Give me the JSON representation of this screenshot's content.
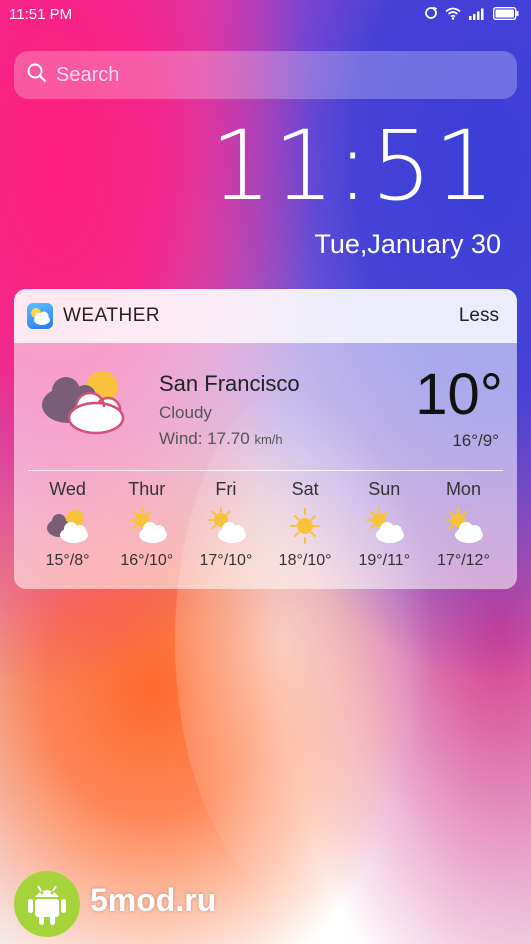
{
  "status_bar": {
    "time": "11:51 PM",
    "icons": [
      "sync-icon",
      "wifi-icon",
      "signal-icon",
      "battery-icon"
    ]
  },
  "search": {
    "placeholder": "Search"
  },
  "clock": {
    "time": "11:51",
    "date": "Tue,January 30"
  },
  "weather": {
    "title": "WEATHER",
    "toggle_label": "Less",
    "city": "San Francisco",
    "condition": "Cloudy",
    "wind_label": "Wind: 17.70",
    "wind_unit": "km/h",
    "temperature": "10°",
    "hi_lo": "16°/9°",
    "current_icon": "cloudy-partly-sunny-icon",
    "forecast": [
      {
        "day": "Wed",
        "range": "15°/8°",
        "icon": "cloudy-partly-sunny-icon"
      },
      {
        "day": "Thur",
        "range": "16°/10°",
        "icon": "partly-sunny-icon"
      },
      {
        "day": "Fri",
        "range": "17°/10°",
        "icon": "partly-sunny-icon"
      },
      {
        "day": "Sat",
        "range": "18°/10°",
        "icon": "sunny-icon"
      },
      {
        "day": "Sun",
        "range": "19°/11°",
        "icon": "partly-sunny-icon"
      },
      {
        "day": "Mon",
        "range": "17°/12°",
        "icon": "partly-sunny-icon"
      }
    ]
  },
  "watermark": {
    "text": "5mod.ru",
    "badge_icon": "android-robot-icon"
  },
  "colors": {
    "sun": "#f8c23c",
    "cloud_dark": "#7a5e78",
    "badge": "#a5d43a"
  }
}
